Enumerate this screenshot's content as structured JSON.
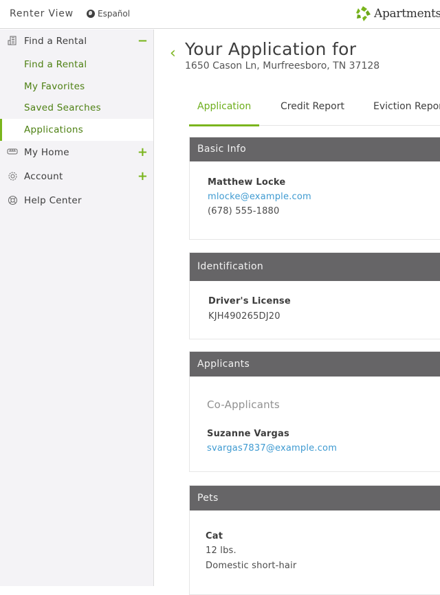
{
  "topbar": {
    "renter_view": "Renter View",
    "language": "Español",
    "logo_text": "Apartments",
    "brand_color": "#7ab51d"
  },
  "sidebar": {
    "sections": [
      {
        "label": "Find a Rental",
        "icon": "building-icon",
        "toggle": "−",
        "expanded": true
      },
      {
        "label": "My Home",
        "icon": "sofa-icon",
        "toggle": "+",
        "expanded": false
      },
      {
        "label": "Account",
        "icon": "gear-icon",
        "toggle": "+",
        "expanded": false
      },
      {
        "label": "Help Center",
        "icon": "lifebuoy-icon",
        "toggle": "",
        "expanded": false
      }
    ],
    "sub_items": [
      {
        "label": "Find a Rental",
        "active": false
      },
      {
        "label": "My Favorites",
        "active": false
      },
      {
        "label": "Saved Searches",
        "active": false
      },
      {
        "label": "Applications",
        "active": true
      }
    ]
  },
  "main": {
    "title": "Your Application for",
    "address": "1650 Cason Ln, Murfreesboro, TN 37128",
    "tabs": [
      {
        "label": "Application",
        "active": true
      },
      {
        "label": "Credit Report",
        "active": false
      },
      {
        "label": "Eviction Report",
        "active": false
      }
    ],
    "cards": {
      "basic_info": {
        "header": "Basic Info",
        "name": "Matthew Locke",
        "email": "mlocke@example.com",
        "phone": "(678) 555-1880"
      },
      "identification": {
        "header": "Identification",
        "id_type": "Driver's License",
        "id_number": "KJH490265DJ20"
      },
      "applicants": {
        "header": "Applicants",
        "subheader": "Co-Applicants",
        "name": "Suzanne Vargas",
        "email": "svargas7837@example.com"
      },
      "pets": {
        "header": "Pets",
        "type": "Cat",
        "weight": "12 lbs.",
        "breed": "Domestic short-hair"
      }
    }
  }
}
